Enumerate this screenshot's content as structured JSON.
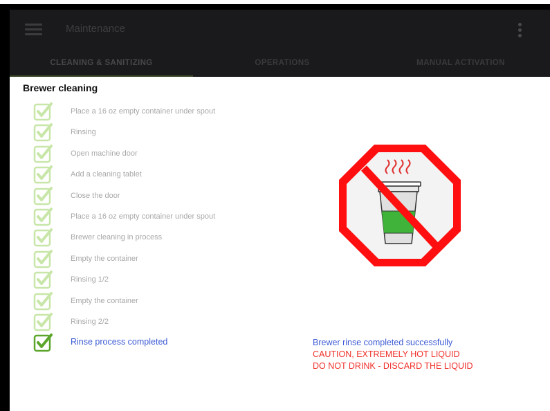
{
  "app": {
    "title": "Maintenance"
  },
  "tabs": [
    {
      "label": "CLEANING & SANITIZING",
      "active": true
    },
    {
      "label": "OPERATIONS",
      "active": false
    },
    {
      "label": "MANUAL ACTIVATION",
      "active": false
    }
  ],
  "section": {
    "title": "Brewer cleaning"
  },
  "steps": [
    {
      "label": "Place a 16 oz empty container under spout",
      "state": "done"
    },
    {
      "label": "Rinsing",
      "state": "done"
    },
    {
      "label": "Open machine door",
      "state": "done"
    },
    {
      "label": "Add a cleaning tablet",
      "state": "done"
    },
    {
      "label": "Close the door",
      "state": "done"
    },
    {
      "label": "Place a 16 oz empty container under spout",
      "state": "done"
    },
    {
      "label": "Brewer cleaning in process",
      "state": "done"
    },
    {
      "label": "Empty the container",
      "state": "done"
    },
    {
      "label": "Rinsing 1/2",
      "state": "done"
    },
    {
      "label": "Empty the container",
      "state": "done"
    },
    {
      "label": "Rinsing 2/2",
      "state": "done"
    },
    {
      "label": "Rinse process completed",
      "state": "current"
    }
  ],
  "status": {
    "success": "Brewer rinse completed successfully",
    "caution": "CAUTION, EXTREMELY HOT LIQUID",
    "discard": "DO NOT DRINK - DISCARD THE LIQUID"
  },
  "icons": {
    "menu": "hamburger-menu-icon",
    "overflow": "more-vertical-icon",
    "step_check": "checkbox-checked-icon",
    "warning": "do-not-drink-hot-liquid-icon"
  },
  "colors": {
    "appbar": "#1a1a1c",
    "check_faded": "#c8e6a8",
    "check_active": "#5aa52a",
    "step_active_text": "#3d5bd4",
    "warning_red": "#f0302a",
    "liquid_green": "#3fb33a"
  }
}
